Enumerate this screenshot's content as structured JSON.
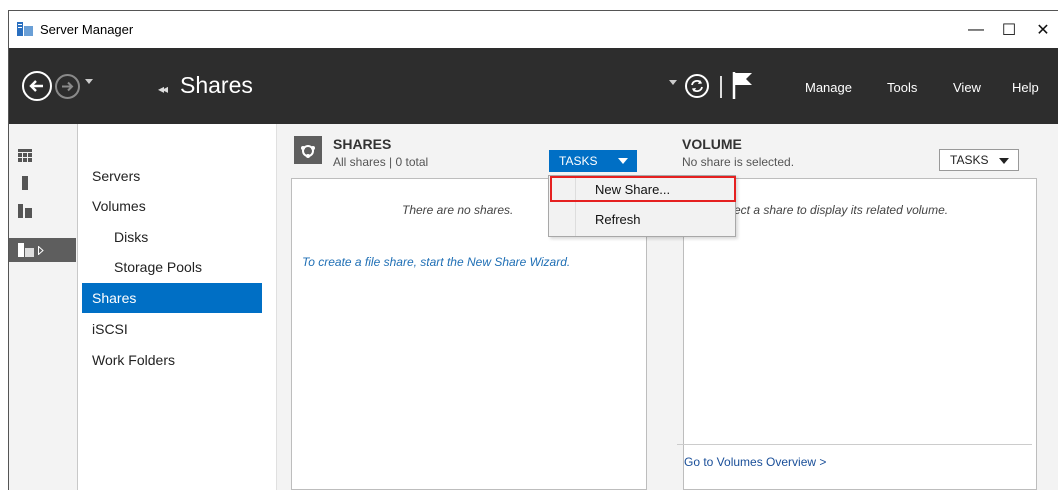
{
  "window": {
    "title": "Server Manager"
  },
  "window_controls": {
    "minimize": "—",
    "maximize": "☐",
    "close": "✕"
  },
  "nav": {
    "breadcrumb_arrows": "◂◂",
    "breadcrumb": "Shares",
    "menu": [
      "Manage",
      "Tools",
      "View",
      "Help"
    ]
  },
  "subnav": {
    "items": [
      "Servers",
      "Volumes",
      "Disks",
      "Storage Pools",
      "Shares",
      "iSCSI",
      "Work Folders"
    ],
    "selected": "Shares"
  },
  "shares": {
    "title": "SHARES",
    "subtitle": "All shares | 0 total",
    "tasks_label": "TASKS",
    "empty_message": "There are no shares.",
    "wizard_link": "To create a file share, start the New Share Wizard."
  },
  "tasks_menu": {
    "items": [
      "New Share...",
      "Refresh"
    ],
    "highlighted": "New Share..."
  },
  "volume": {
    "title": "VOLUME",
    "subtitle": "No share is selected.",
    "tasks_label": "TASKS",
    "message": "ect a share to display its related volume.",
    "footer_link": "Go to Volumes Overview >"
  },
  "colors": {
    "accent": "#006fc5",
    "navbar": "#2d2d2d",
    "highlight_border": "#e52020"
  }
}
